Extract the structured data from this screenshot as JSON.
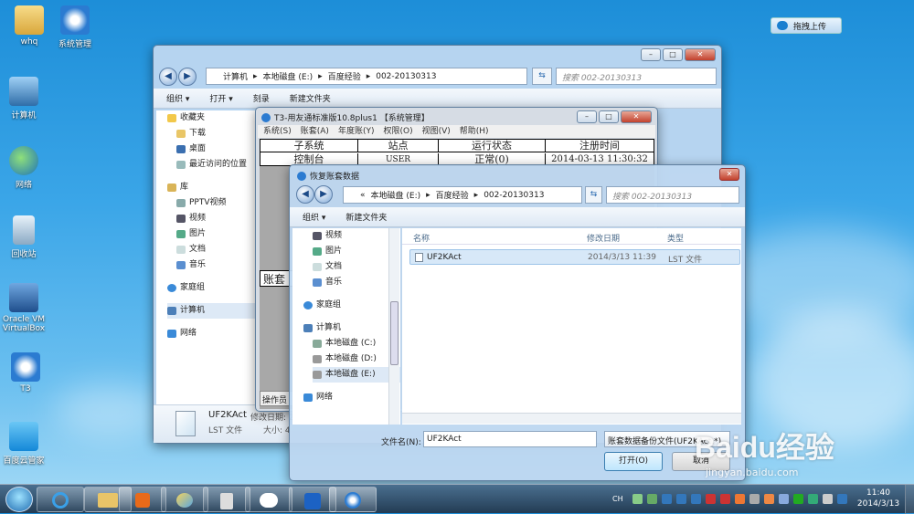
{
  "desktop": {
    "icons": [
      "whq",
      "系统管理",
      "计算机",
      "网络",
      "回收站",
      "Oracle VM VirtualBox",
      "T3",
      "百度云管家"
    ]
  },
  "upload_button": "拖拽上传",
  "explorer": {
    "breadcrumb": [
      "计算机",
      "本地磁盘 (E:)",
      "百度经验",
      "002-20130313"
    ],
    "search_placeholder": "搜索 002-20130313",
    "toolbar": [
      "组织 ▾",
      "打开 ▾",
      "刻录",
      "新建文件夹"
    ],
    "nav": [
      "收藏夹",
      "下载",
      "桌面",
      "最近访问的位置",
      "库",
      "PPTV视频",
      "视频",
      "图片",
      "文档",
      "音乐",
      "家庭组",
      "计算机",
      "网络"
    ],
    "details": {
      "name": "UF2KAct",
      "modified_label": "修改日期: 2",
      "type": "LST 文件",
      "size_label": "大小: 4"
    }
  },
  "t3": {
    "title": "T3-用友通标准版10.8plus1 【系统管理】",
    "menu": [
      "系统(S)",
      "账套(A)",
      "年度账(Y)",
      "权限(O)",
      "视图(V)",
      "帮助(H)"
    ],
    "table_headers": [
      "子系统",
      "站点",
      "运行状态",
      "注册时间"
    ],
    "table_row": [
      "控制台",
      "USER",
      "正常(0)",
      "2014-03-13 11:30:32"
    ],
    "side_label": "账套",
    "operator_label": "操作员"
  },
  "dialog": {
    "title": "恢复账套数据",
    "breadcrumb": [
      "«",
      "本地磁盘 (E:)",
      "百度经验",
      "002-20130313"
    ],
    "search_placeholder": "搜索 002-20130313",
    "toolbar": [
      "组织 ▾",
      "新建文件夹"
    ],
    "nav": [
      "视频",
      "图片",
      "文档",
      "音乐",
      "家庭组",
      "计算机",
      "本地磁盘 (C:)",
      "本地磁盘 (D:)",
      "本地磁盘 (E:)",
      "网络"
    ],
    "columns": [
      "名称",
      "修改日期",
      "类型"
    ],
    "files": [
      {
        "name": "UF2KAct",
        "date": "2014/3/13 11:39",
        "type": "LST 文件"
      }
    ],
    "filename_label": "文件名(N):",
    "filename_value": "UF2KAct",
    "filter_value": "账套数据备份文件(UF2KAct.*)",
    "open_label": "打开(O)",
    "cancel_label": "取消"
  },
  "taskbar": {
    "lang": "CH",
    "time": "11:40",
    "date": "2014/3/13"
  },
  "watermark": {
    "logo": "Baidu经验",
    "url": "jingyan.baidu.com"
  }
}
